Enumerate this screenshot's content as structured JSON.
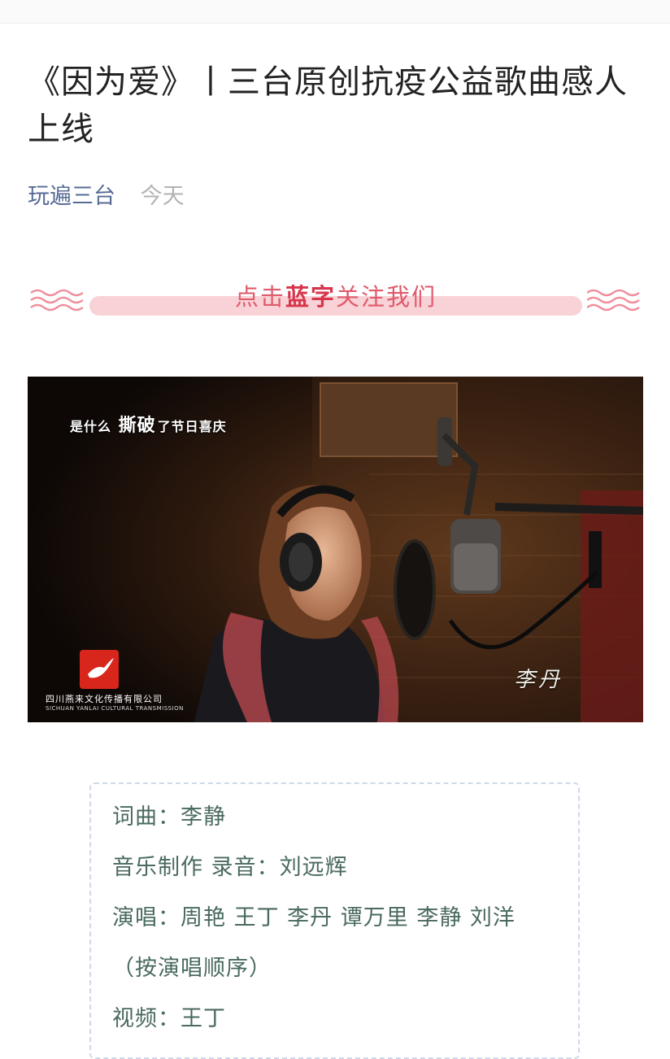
{
  "article": {
    "title": "《因为爱》丨三台原创抗疫公益歌曲感人上线",
    "account_name": "玩遍三台",
    "date": "今天"
  },
  "follow_banner": {
    "prefix": "点击",
    "highlight": "蓝字",
    "suffix": "关注我们"
  },
  "video_frame": {
    "caption_pre": "是什么",
    "caption_big": "撕破",
    "caption_post": "了节日喜庆",
    "singer_name": "李丹",
    "logo_cn": "四川燕来文化传播有限公司",
    "logo_en": "SICHUAN YANLAI CULTURAL TRANSMISSION"
  },
  "credits": [
    "词曲：李静",
    "音乐制作 录音：刘远辉",
    "演唱：周艳 王丁 李丹 谭万里 李静 刘洋",
    "（按演唱顺序）",
    "视频：王丁"
  ],
  "colors": {
    "account": "#576b95",
    "banner_text": "#e05a6b",
    "banner_pill": "#f8d2d6",
    "credits_text": "#4a6a5e",
    "credits_border": "#cfd9ea"
  }
}
